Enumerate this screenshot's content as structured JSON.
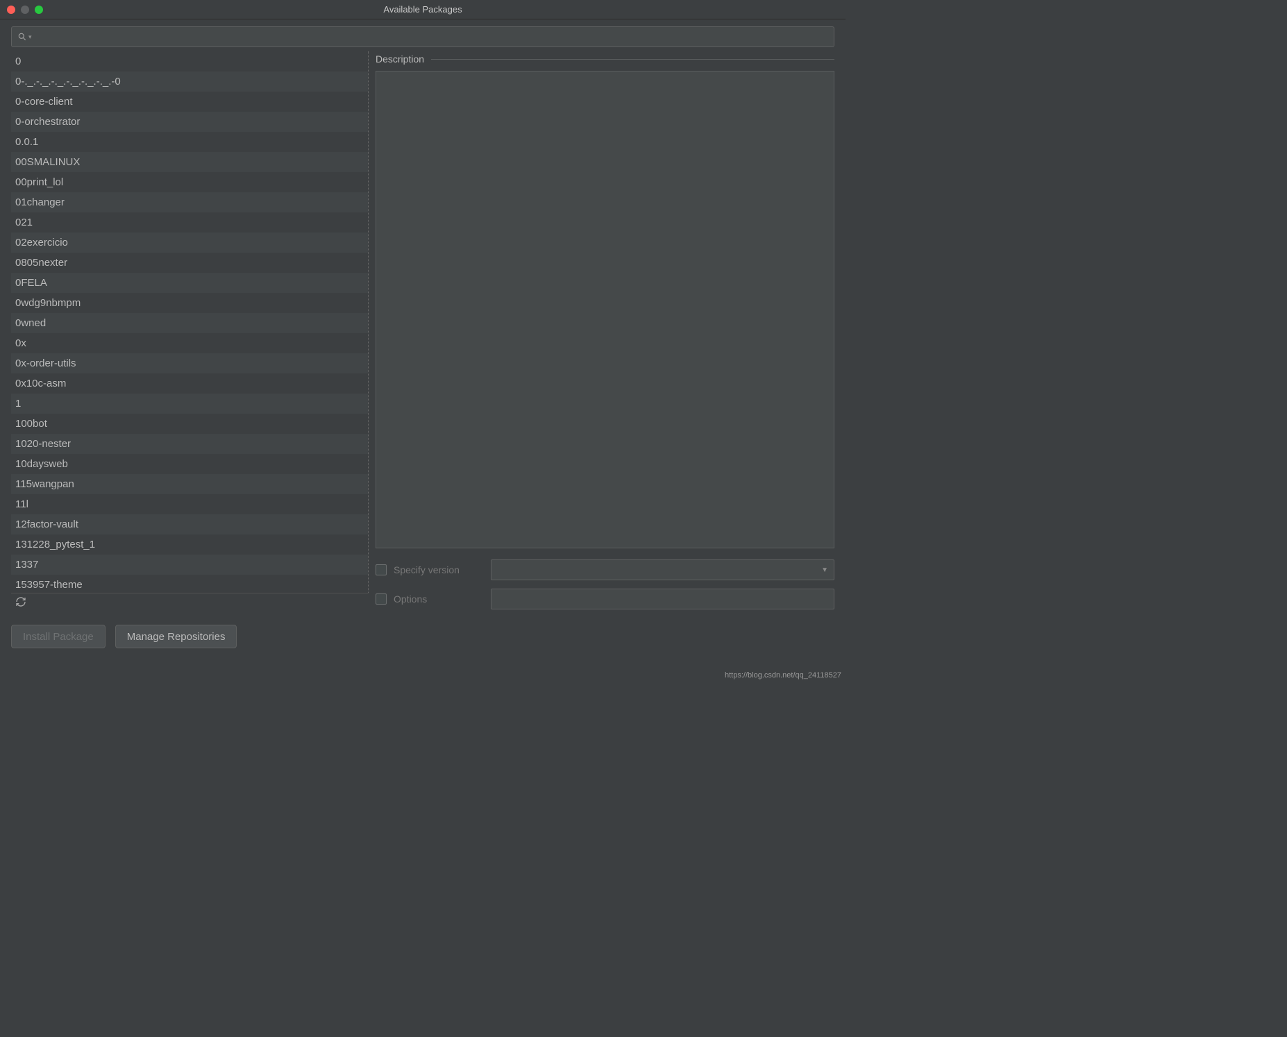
{
  "window": {
    "title": "Available Packages"
  },
  "search": {
    "placeholder": ""
  },
  "packages": [
    "0",
    "0-._.-._.-._.-._.-._.-._.-0",
    "0-core-client",
    "0-orchestrator",
    "0.0.1",
    "00SMALINUX",
    "00print_lol",
    "01changer",
    "021",
    "02exercicio",
    "0805nexter",
    "0FELA",
    "0wdg9nbmpm",
    "0wned",
    "0x",
    "0x-order-utils",
    "0x10c-asm",
    "1",
    "100bot",
    "1020-nester",
    "10daysweb",
    "115wangpan",
    "11l",
    "12factor-vault",
    "131228_pytest_1",
    "1337",
    "153957-theme"
  ],
  "right": {
    "description_label": "Description",
    "specify_version_label": "Specify version",
    "options_label": "Options"
  },
  "footer": {
    "install_label": "Install Package",
    "manage_label": "Manage Repositories"
  },
  "watermark": "https://blog.csdn.net/qq_24118527"
}
